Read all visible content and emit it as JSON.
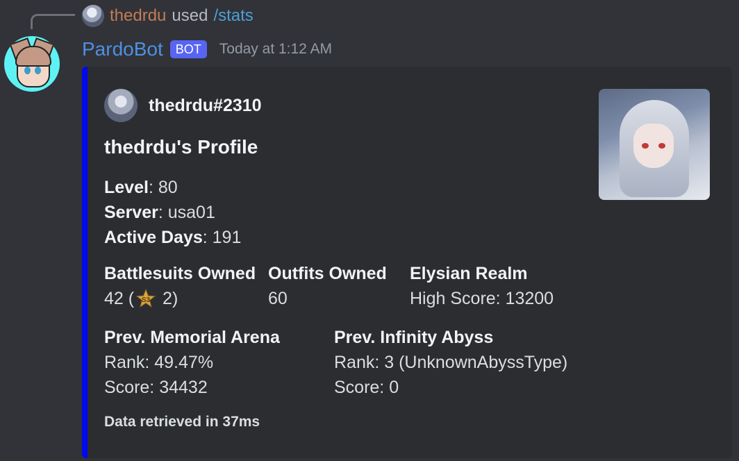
{
  "reply": {
    "username": "thedrdu",
    "verb": "used",
    "command": "/stats"
  },
  "header": {
    "bot_name": "PardoBot",
    "badge": "BOT",
    "timestamp": "Today at 1:12 AM"
  },
  "embed": {
    "color": "#0008f0",
    "author": "thedrdu#2310",
    "title": "thedrdu's Profile",
    "description": [
      {
        "label": "Level",
        "value": ": 80"
      },
      {
        "label": "Server",
        "value": ": usa01"
      },
      {
        "label": "Active Days",
        "value": ": 191"
      }
    ],
    "fields_row1": [
      {
        "name": "Battlesuits Owned",
        "value_before": "42 (",
        "icon": "s3-rank-icon",
        "value_after": " 2)"
      },
      {
        "name": "Outfits Owned",
        "value": "60"
      },
      {
        "name": "Elysian Realm",
        "value": "High Score: 13200"
      }
    ],
    "fields_row2": [
      {
        "name": "Prev. Memorial Arena",
        "lines": [
          "Rank: 49.47%",
          "Score: 34432"
        ]
      },
      {
        "name": "Prev. Infinity Abyss",
        "lines": [
          "Rank: 3 (UnknownAbyssType)",
          "Score: 0"
        ]
      }
    ],
    "footer": "Data retrieved in 37ms"
  }
}
